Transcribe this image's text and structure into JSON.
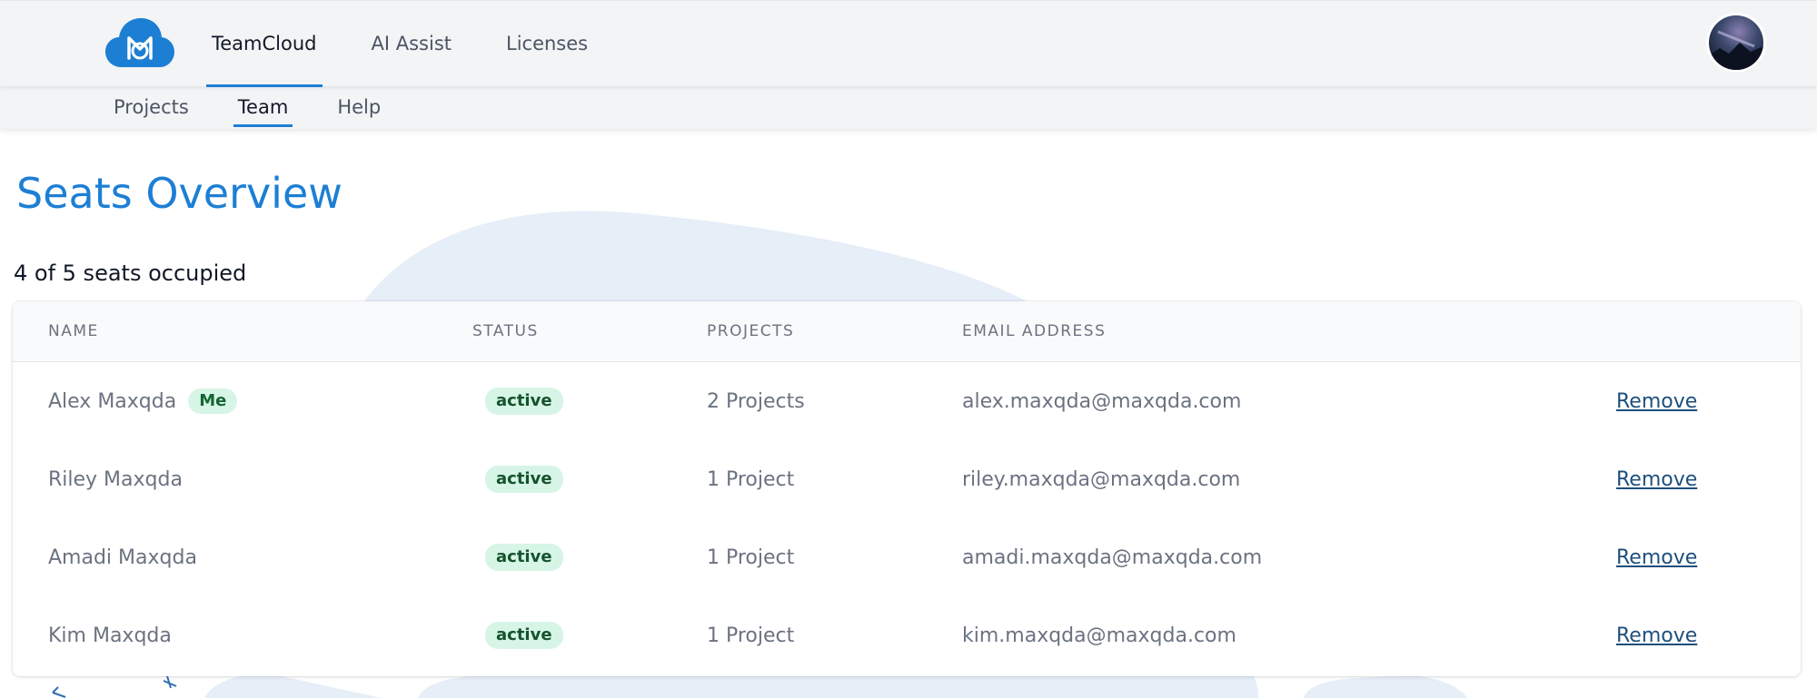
{
  "header": {
    "nav": [
      {
        "label": "TeamCloud",
        "active": true
      },
      {
        "label": "AI Assist",
        "active": false
      },
      {
        "label": "Licenses",
        "active": false
      }
    ],
    "logo_icon": "cloud-logo-icon",
    "avatar_icon": "user-avatar"
  },
  "subnav": [
    {
      "label": "Projects",
      "active": false
    },
    {
      "label": "Team",
      "active": true
    },
    {
      "label": "Help",
      "active": false
    }
  ],
  "page": {
    "title": "Seats Overview",
    "seat_summary": "4 of 5 seats occupied"
  },
  "table": {
    "columns": [
      "NAME",
      "STATUS",
      "PROJECTS",
      "EMAIL ADDRESS"
    ],
    "rows": [
      {
        "name": "Alex Maxqda",
        "badge": "Me",
        "status": "active",
        "projects": "2 Projects",
        "email": "alex.maxqda@maxqda.com",
        "action": "Remove"
      },
      {
        "name": "Riley Maxqda",
        "badge": "",
        "status": "active",
        "projects": "1 Project",
        "email": "riley.maxqda@maxqda.com",
        "action": "Remove"
      },
      {
        "name": "Amadi Maxqda",
        "badge": "",
        "status": "active",
        "projects": "1 Project",
        "email": "amadi.maxqda@maxqda.com",
        "action": "Remove"
      },
      {
        "name": "Kim Maxqda",
        "badge": "",
        "status": "active",
        "projects": "1 Project",
        "email": "kim.maxqda@maxqda.com",
        "action": "Remove"
      }
    ]
  },
  "colors": {
    "accent": "#1d7fd4",
    "badge_bg": "#d7f5e6",
    "link": "#1e4f7d",
    "bar_bg": "#f3f4f6"
  }
}
